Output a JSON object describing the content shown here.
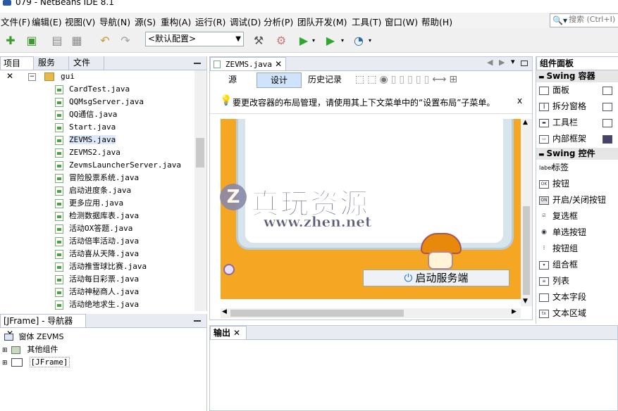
{
  "window": {
    "title": "079 - NetBeans IDE 8.1"
  },
  "menu": [
    "文件(F)",
    "编辑(E)",
    "视图(V)",
    "导航(N)",
    "源(S)",
    "重构(A)",
    "运行(R)",
    "调试(D)",
    "分析(P)",
    "团队开发(M)",
    "工具(T)",
    "窗口(W)",
    "帮助(H)"
  ],
  "search": {
    "placeholder": "搜索 (Ctrl+I)"
  },
  "toolbar": {
    "config_value": "<默认配置>"
  },
  "project_panel": {
    "tabs": [
      "项目",
      "服务",
      "文件"
    ],
    "folder": "gui",
    "files": [
      "CardTest.java",
      "QQMsgServer.java",
      "QQ通信.java",
      "Start.java",
      "ZEVMS.java",
      "ZEVMS2.java",
      "ZevmsLauncherServer.java",
      "冒险股票系统.java",
      "启动进度条.java",
      "更多应用.java",
      "检测数据库表.java",
      "活动OX答题.java",
      "活动倍率活动.java",
      "活动喜从天降.java",
      "活动推雪球比赛.java",
      "活动每日彩票.java",
      "活动神秘商人.java",
      "活动绝地求生.java"
    ]
  },
  "navigator": {
    "title": "[JFrame] - 导航器",
    "root": "窗体 ZEVMS",
    "children": [
      "其他组件",
      "[JFrame]"
    ]
  },
  "editor": {
    "file_tab": "ZEVMS.java",
    "view_tabs": [
      "源",
      "设计",
      "历史记录"
    ],
    "active_view": "设计",
    "hint": "要更改容器的布局管理，请使用其上下文菜单中的“设置布局”子菜单。",
    "hint_close": "x",
    "start_button": "启动服务端"
  },
  "watermark": {
    "title": "真玩资源",
    "url": "www.zhen.net",
    "letter": "Z"
  },
  "output": {
    "tab": "输出"
  },
  "palette": {
    "title": "组件面板",
    "sections": [
      {
        "name": "Swing 容器",
        "items": [
          "面板",
          "拆分窗格",
          "工具栏",
          "内部框架"
        ]
      },
      {
        "name": "Swing 控件",
        "items": [
          "标签",
          "按钮",
          "开启/关闭按钮",
          "复选框",
          "单选按钮",
          "按钮组",
          "组合框",
          "列表",
          "文本字段",
          "文本区域"
        ]
      }
    ],
    "icon_labels": [
      "label",
      "OK",
      "ON"
    ]
  },
  "colors": {
    "canvas_orange": "#f5a623",
    "accent_green": "#2ea82e",
    "selection_blue": "#cfe3fb"
  }
}
